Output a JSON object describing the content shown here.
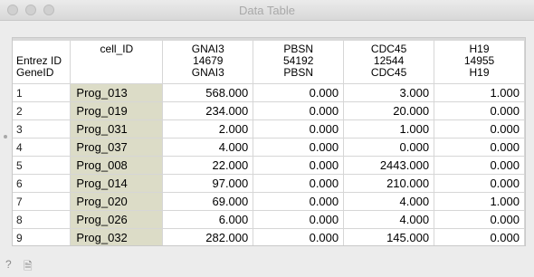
{
  "window": {
    "title": "Data Table"
  },
  "table": {
    "meta_column_header": "cell_ID",
    "row_header_labels": [
      "Entrez ID",
      "GeneID"
    ],
    "columns": [
      {
        "name": "GNAI3",
        "entrez": "14679",
        "gene": "GNAI3"
      },
      {
        "name": "PBSN",
        "entrez": "54192",
        "gene": "PBSN"
      },
      {
        "name": "CDC45",
        "entrez": "12544",
        "gene": "CDC45"
      },
      {
        "name": "H19",
        "entrez": "14955",
        "gene": "H19"
      }
    ],
    "rows": [
      {
        "index": "1",
        "cell_id": "Prog_013",
        "values": [
          "568.000",
          "0.000",
          "3.000",
          "1.000"
        ]
      },
      {
        "index": "2",
        "cell_id": "Prog_019",
        "values": [
          "234.000",
          "0.000",
          "20.000",
          "0.000"
        ]
      },
      {
        "index": "3",
        "cell_id": "Prog_031",
        "values": [
          "2.000",
          "0.000",
          "1.000",
          "0.000"
        ]
      },
      {
        "index": "4",
        "cell_id": "Prog_037",
        "values": [
          "4.000",
          "0.000",
          "0.000",
          "0.000"
        ]
      },
      {
        "index": "5",
        "cell_id": "Prog_008",
        "values": [
          "22.000",
          "0.000",
          "2443.000",
          "0.000"
        ]
      },
      {
        "index": "6",
        "cell_id": "Prog_014",
        "values": [
          "97.000",
          "0.000",
          "210.000",
          "0.000"
        ]
      },
      {
        "index": "7",
        "cell_id": "Prog_020",
        "values": [
          "69.000",
          "0.000",
          "4.000",
          "1.000"
        ]
      },
      {
        "index": "8",
        "cell_id": "Prog_026",
        "values": [
          "6.000",
          "0.000",
          "4.000",
          "0.000"
        ]
      },
      {
        "index": "9",
        "cell_id": "Prog_032",
        "values": [
          "282.000",
          "0.000",
          "145.000",
          "0.000"
        ]
      }
    ]
  },
  "statusbar": {
    "icons": [
      "help-icon",
      "report-icon"
    ],
    "help_glyph": "?",
    "report_glyph": "🗎"
  }
}
